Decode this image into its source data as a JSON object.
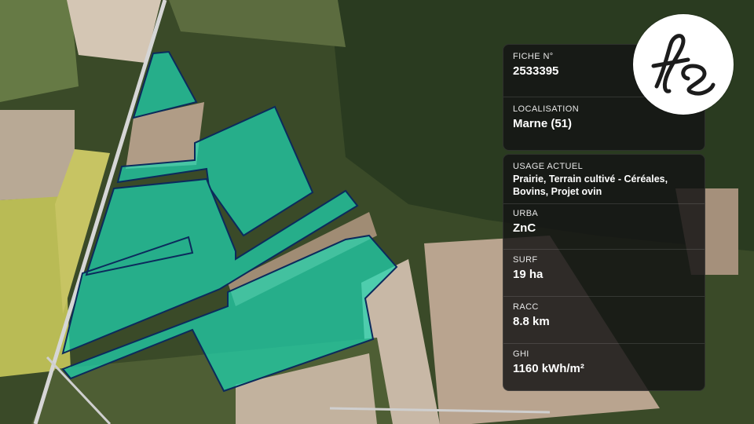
{
  "map": {
    "colors": {
      "parcel_fill": "#1fd6b0",
      "parcel_stroke": "#0b2a5c",
      "forest": "#27391f",
      "field_light": "#b7a38e",
      "field_green": "#586b3c",
      "road": "#d9d9d9"
    }
  },
  "card_top": {
    "fiche_label": "FICHE N°",
    "fiche_value": "2533395",
    "localisation_label": "LOCALISATION",
    "localisation_value": "Marne (51)"
  },
  "card_bottom": {
    "usage_label": "USAGE ACTUEL",
    "usage_value": "Prairie, Terrain cultivé - Céréales, Bovins, Projet ovin",
    "urba_label": "URBA",
    "urba_value": "ZnC",
    "surf_label": "SURF",
    "surf_value": "19 ha",
    "racc_label": "RACC",
    "racc_value": "8.8 km",
    "ghi_label": "GHI",
    "ghi_value": "1160 kWh/m²"
  },
  "logo": {
    "text": "fs",
    "icon": "fs-monogram-logo"
  }
}
